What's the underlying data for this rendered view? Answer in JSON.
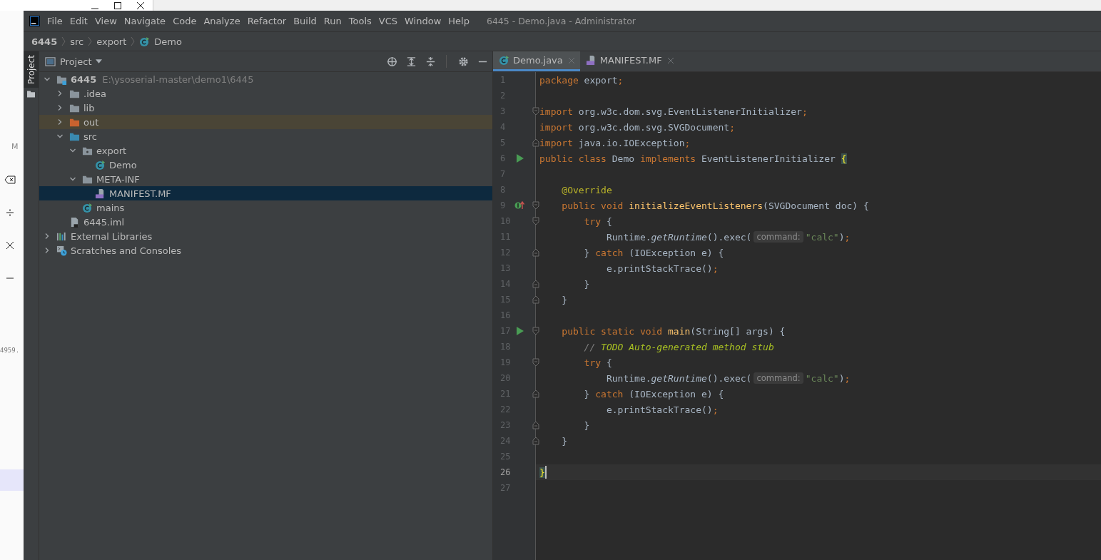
{
  "background_window": {
    "memory_label": "M",
    "history_text": "4959."
  },
  "ide": {
    "title": "6445 - Demo.java - Administrator",
    "menu": [
      "File",
      "Edit",
      "View",
      "Navigate",
      "Code",
      "Analyze",
      "Refactor",
      "Build",
      "Run",
      "Tools",
      "VCS",
      "Window",
      "Help"
    ],
    "breadcrumb": [
      {
        "label": "6445",
        "kind": "project"
      },
      {
        "label": "src",
        "kind": "plain"
      },
      {
        "label": "export",
        "kind": "plain"
      },
      {
        "label": "Demo",
        "kind": "class"
      }
    ],
    "tool_strip": {
      "label": "Project",
      "selected": true
    },
    "project_panel": {
      "title": "Project",
      "tree": [
        {
          "label": "6445",
          "detail": "E:\\ysoserial-master\\demo1\\6445",
          "kind": "project",
          "expanded": true,
          "selected": false,
          "children": [
            {
              "label": ".idea",
              "kind": "folder",
              "expanded": false,
              "selected": false
            },
            {
              "label": "lib",
              "kind": "folder",
              "expanded": false,
              "selected": false
            },
            {
              "label": "out",
              "kind": "excluded",
              "expanded": false,
              "selected": false
            },
            {
              "label": "src",
              "kind": "source",
              "expanded": true,
              "selected": false,
              "children": [
                {
                  "label": "export",
                  "kind": "package",
                  "expanded": true,
                  "selected": false,
                  "children": [
                    {
                      "label": "Demo",
                      "kind": "class",
                      "selected": false
                    }
                  ]
                },
                {
                  "label": "META-INF",
                  "kind": "folder",
                  "expanded": true,
                  "selected": false,
                  "children": [
                    {
                      "label": "MANIFEST.MF",
                      "kind": "manifest",
                      "selected": true
                    }
                  ]
                },
                {
                  "label": "mains",
                  "kind": "class",
                  "selected": false
                }
              ]
            },
            {
              "label": "6445.iml",
              "kind": "module",
              "selected": false
            }
          ]
        },
        {
          "label": "External Libraries",
          "kind": "libraries",
          "expanded": false,
          "selected": false
        },
        {
          "label": "Scratches and Consoles",
          "kind": "scratches",
          "expanded": false,
          "selected": false
        }
      ]
    },
    "editor": {
      "tabs": [
        {
          "label": "Demo.java",
          "kind": "class",
          "selected": true
        },
        {
          "label": "MANIFEST.MF",
          "kind": "manifest",
          "selected": false
        }
      ],
      "lines": [
        {
          "number": "1",
          "current": false,
          "tokens": [
            {
              "text": "package",
              "kind": "kw"
            },
            {
              "text": " export",
              "kind": "plain"
            },
            {
              "text": ";",
              "kind": "kw"
            }
          ]
        },
        {
          "number": "2",
          "current": false
        },
        {
          "number": "3",
          "current": false,
          "fold_marker": {
            "kind": "open"
          },
          "tokens": [
            {
              "text": "import",
              "kind": "kw"
            },
            {
              "text": " org.w3c.dom.svg.EventListenerInitializer",
              "kind": "plain"
            },
            {
              "text": ";",
              "kind": "kw"
            }
          ]
        },
        {
          "number": "4",
          "current": false,
          "tokens": [
            {
              "text": "import",
              "kind": "kw"
            },
            {
              "text": " org.w3c.dom.svg.SVGDocument",
              "kind": "plain"
            },
            {
              "text": ";",
              "kind": "kw"
            }
          ]
        },
        {
          "number": "5",
          "current": false,
          "fold_marker": {
            "kind": "close"
          },
          "tokens": [
            {
              "text": "import",
              "kind": "kw"
            },
            {
              "text": " java.io.IOException",
              "kind": "plain"
            },
            {
              "text": ";",
              "kind": "kw"
            }
          ]
        },
        {
          "number": "6",
          "current": false,
          "gutter_icon": {
            "kind": "run"
          },
          "tokens": [
            {
              "text": "public class",
              "kind": "kw"
            },
            {
              "text": " Demo ",
              "kind": "plain"
            },
            {
              "text": "implements",
              "kind": "kw"
            },
            {
              "text": " EventListenerInitializer ",
              "kind": "plain"
            },
            {
              "text": "{",
              "kind": "match"
            }
          ]
        },
        {
          "number": "7",
          "current": false
        },
        {
          "number": "8",
          "current": false,
          "tokens": [
            {
              "text": "    @Override",
              "kind": "ann"
            }
          ]
        },
        {
          "number": "9",
          "current": false,
          "gutter_icon": {
            "kind": "override"
          },
          "fold_marker": {
            "kind": "open"
          },
          "tokens": [
            {
              "text": "    public void ",
              "kind": "kw"
            },
            {
              "text": "initializeEventListeners",
              "kind": "decl"
            },
            {
              "text": "(SVGDocument doc) {",
              "kind": "plain"
            }
          ]
        },
        {
          "number": "10",
          "current": false,
          "fold_marker": {
            "kind": "open"
          },
          "tokens": [
            {
              "text": "        try",
              "kind": "kw"
            },
            {
              "text": " {",
              "kind": "plain"
            }
          ]
        },
        {
          "number": "11",
          "current": false,
          "tokens": [
            {
              "text": "            Runtime.",
              "kind": "plain"
            },
            {
              "text": "getRuntime",
              "kind": "static"
            },
            {
              "text": "().exec(",
              "kind": "plain"
            },
            {
              "text": "command:",
              "kind": "hint"
            },
            {
              "text": "\"calc\"",
              "kind": "str"
            },
            {
              "text": ")",
              "kind": "plain"
            },
            {
              "text": ";",
              "kind": "kw"
            }
          ]
        },
        {
          "number": "12",
          "current": false,
          "fold_marker": {
            "kind": "close"
          },
          "tokens": [
            {
              "text": "        } ",
              "kind": "plain"
            },
            {
              "text": "catch",
              "kind": "kw"
            },
            {
              "text": " (IOException e) {",
              "kind": "plain"
            }
          ]
        },
        {
          "number": "13",
          "current": false,
          "tokens": [
            {
              "text": "            e.printStackTrace()",
              "kind": "plain"
            },
            {
              "text": ";",
              "kind": "kw"
            }
          ]
        },
        {
          "number": "14",
          "current": false,
          "fold_marker": {
            "kind": "close"
          },
          "tokens": [
            {
              "text": "        }",
              "kind": "plain"
            }
          ]
        },
        {
          "number": "15",
          "current": false,
          "fold_marker": {
            "kind": "close"
          },
          "tokens": [
            {
              "text": "    }",
              "kind": "plain"
            }
          ]
        },
        {
          "number": "16",
          "current": false
        },
        {
          "number": "17",
          "current": false,
          "gutter_icon": {
            "kind": "run"
          },
          "fold_marker": {
            "kind": "open"
          },
          "tokens": [
            {
              "text": "    public static void ",
              "kind": "kw"
            },
            {
              "text": "main",
              "kind": "decl"
            },
            {
              "text": "(String[] args) {",
              "kind": "plain"
            }
          ]
        },
        {
          "number": "18",
          "current": false,
          "tokens": [
            {
              "text": "        // ",
              "kind": "comment"
            },
            {
              "text": "TODO Auto-generated method stub",
              "kind": "todo"
            }
          ]
        },
        {
          "number": "19",
          "current": false,
          "fold_marker": {
            "kind": "open"
          },
          "tokens": [
            {
              "text": "        try",
              "kind": "kw"
            },
            {
              "text": " {",
              "kind": "plain"
            }
          ]
        },
        {
          "number": "20",
          "current": false,
          "tokens": [
            {
              "text": "            Runtime.",
              "kind": "plain"
            },
            {
              "text": "getRuntime",
              "kind": "static"
            },
            {
              "text": "().exec(",
              "kind": "plain"
            },
            {
              "text": "command:",
              "kind": "hint"
            },
            {
              "text": "\"calc\"",
              "kind": "str"
            },
            {
              "text": ")",
              "kind": "plain"
            },
            {
              "text": ";",
              "kind": "kw"
            }
          ]
        },
        {
          "number": "21",
          "current": false,
          "fold_marker": {
            "kind": "close"
          },
          "tokens": [
            {
              "text": "        } ",
              "kind": "plain"
            },
            {
              "text": "catch",
              "kind": "kw"
            },
            {
              "text": " (IOException e) {",
              "kind": "plain"
            }
          ]
        },
        {
          "number": "22",
          "current": false,
          "tokens": [
            {
              "text": "            e.printStackTrace()",
              "kind": "plain"
            },
            {
              "text": ";",
              "kind": "kw"
            }
          ]
        },
        {
          "number": "23",
          "current": false,
          "fold_marker": {
            "kind": "close"
          },
          "tokens": [
            {
              "text": "        }",
              "kind": "plain"
            }
          ]
        },
        {
          "number": "24",
          "current": false,
          "fold_marker": {
            "kind": "close"
          },
          "tokens": [
            {
              "text": "    }",
              "kind": "plain"
            }
          ]
        },
        {
          "number": "25",
          "current": false
        },
        {
          "number": "26",
          "current": true,
          "tokens": [
            {
              "text": "}",
              "kind": "match"
            }
          ]
        },
        {
          "number": "27",
          "current": false
        }
      ]
    }
  }
}
